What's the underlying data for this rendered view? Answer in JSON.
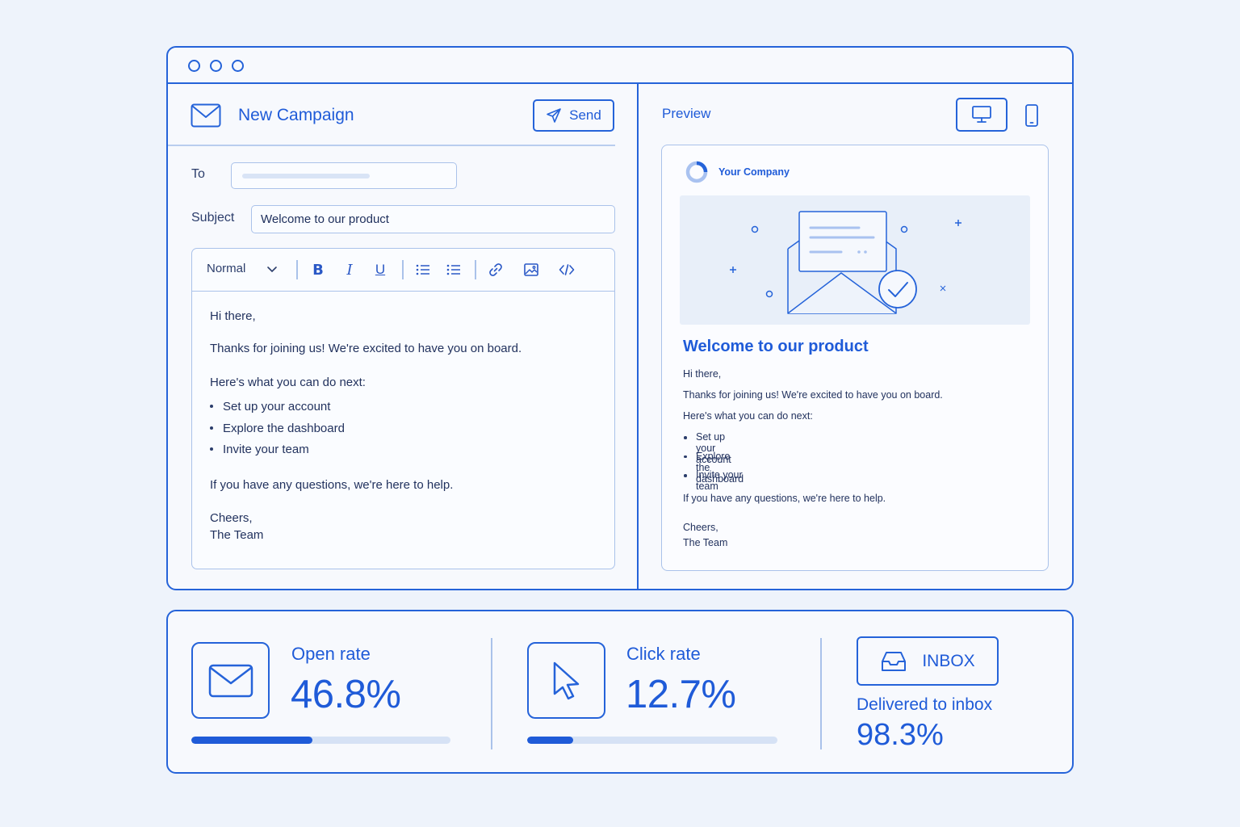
{
  "window": {
    "controls": [
      "circle",
      "circle",
      "circle"
    ]
  },
  "composer": {
    "title": "New Campaign",
    "title_icon": "envelope-icon",
    "send_label": "Send",
    "send_icon": "paper-plane-icon",
    "to_label": "To",
    "to_value": "",
    "subject_label": "Subject",
    "subject_value": "Welcome to our product",
    "toolbar": {
      "style_select": "Normal",
      "bold": "B",
      "italic": "I",
      "underline": "U",
      "icons": [
        "chevron-down-icon",
        "bulleted-list-icon",
        "numbered-list-icon",
        "link-icon",
        "image-icon",
        "code-icon"
      ]
    },
    "body": {
      "greeting": "Hi there,",
      "intro": "Thanks for joining us! We're excited to have you on board.",
      "next_intro": "Here's what you can do next:",
      "items": [
        "Set up your account",
        "Explore the dashboard",
        "Invite your team"
      ],
      "help": "If you have any questions, we're here to help.",
      "signoff": "Cheers,",
      "signature": "The Team"
    }
  },
  "preview": {
    "label": "Preview",
    "devices": [
      "desktop-icon",
      "mobile-icon"
    ],
    "company": "Your Company",
    "heading": "Welcome to our product",
    "greeting": "Hi there,",
    "intro": "Thanks for joining us! We're excited to have you on board.",
    "next_intro": "Here's what you can do next:",
    "items": [
      "Set up your account",
      "Explore the dashboard",
      "Invite your team"
    ],
    "help": "If you have any questions, we're here to help.",
    "signoff": "Cheers,",
    "signature": "The Team"
  },
  "stats": {
    "open_rate": {
      "label": "Open rate",
      "value": "46.8%",
      "progress": 0.468,
      "icon": "envelope-icon"
    },
    "click_rate": {
      "label": "Click rate",
      "value": "12.7%",
      "progress": 0.127,
      "icon": "cursor-icon"
    },
    "inbox": {
      "badge": "INBOX",
      "icon": "inbox-tray-icon",
      "label": "Delivered to inbox",
      "value": "98.3%"
    }
  },
  "colors": {
    "accent": "#1f5bd8",
    "border": "#2563d9",
    "background": "#eef3fb",
    "track": "#d6e2f5"
  }
}
